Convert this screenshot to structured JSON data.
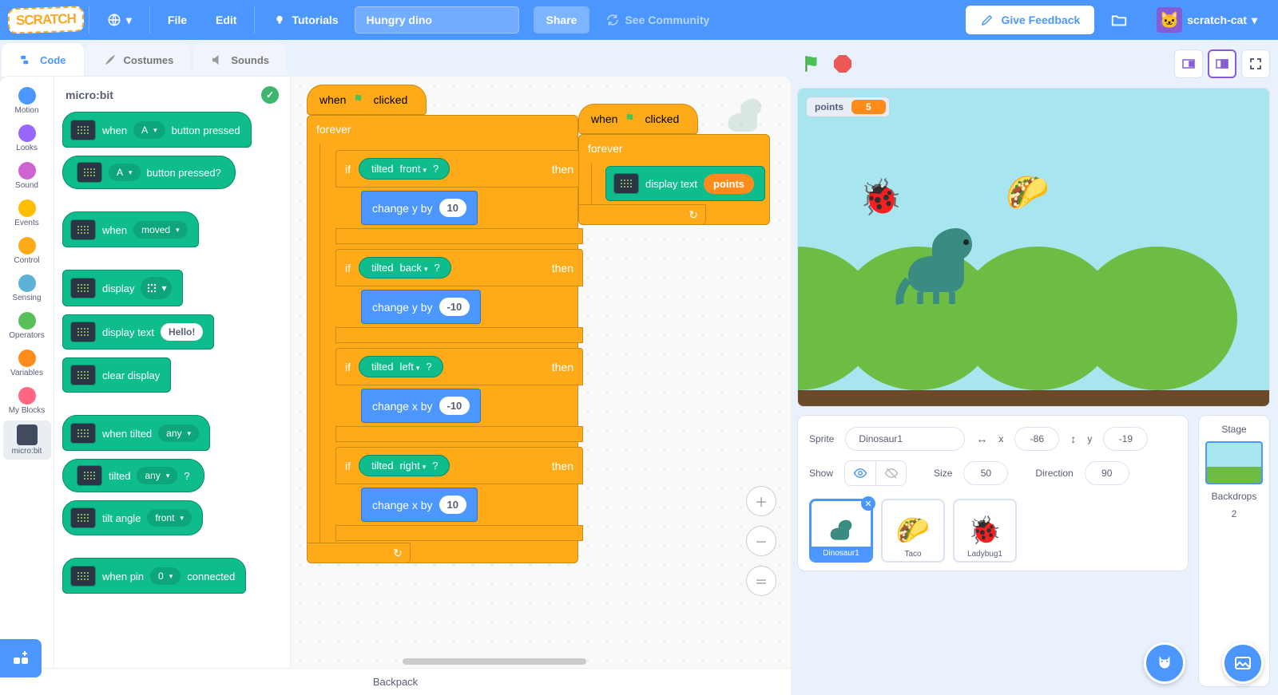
{
  "menubar": {
    "logo": "SCRATCH",
    "file": "File",
    "edit": "Edit",
    "tutorials": "Tutorials",
    "project_title": "Hungry dino",
    "share": "Share",
    "see_community": "See Community",
    "give_feedback": "Give Feedback",
    "username": "scratch-cat"
  },
  "tabs": {
    "code": "Code",
    "costumes": "Costumes",
    "sounds": "Sounds"
  },
  "categories": [
    {
      "label": "Motion",
      "color": "#4c97ff"
    },
    {
      "label": "Looks",
      "color": "#9966ff"
    },
    {
      "label": "Sound",
      "color": "#cf63cf"
    },
    {
      "label": "Events",
      "color": "#ffbf00"
    },
    {
      "label": "Control",
      "color": "#ffab19"
    },
    {
      "label": "Sensing",
      "color": "#5cb1d6"
    },
    {
      "label": "Operators",
      "color": "#59c059"
    },
    {
      "label": "Variables",
      "color": "#ff8c1a"
    },
    {
      "label": "My Blocks",
      "color": "#ff6680"
    },
    {
      "label": "micro:bit",
      "color": "#424a60"
    }
  ],
  "palette": {
    "title": "micro:bit",
    "blocks": {
      "when_button": {
        "when": "when",
        "option": "A",
        "button_pressed": "button pressed"
      },
      "button_pressed_bool": {
        "option": "A",
        "text": "button pressed?"
      },
      "when_moved": {
        "when": "when",
        "option": "moved"
      },
      "display": "display",
      "display_text": {
        "label": "display text",
        "value": "Hello!"
      },
      "clear": "clear display",
      "when_tilted": {
        "label": "when tilted",
        "option": "any"
      },
      "tilted_bool": {
        "label": "tilted",
        "option": "any",
        "q": "?"
      },
      "tilt_angle": {
        "label": "tilt angle",
        "option": "front"
      },
      "when_pin": {
        "label": "when pin",
        "option": "0",
        "connected": "connected"
      }
    }
  },
  "workspace": {
    "hat1": {
      "when": "when",
      "clicked": "clicked"
    },
    "forever": "forever",
    "if": "if",
    "then": "then",
    "tilted": "tilted",
    "q": "?",
    "dirs": {
      "front": "front",
      "back": "back",
      "left": "left",
      "right": "right"
    },
    "change_y": "change y by",
    "change_x": "change x by",
    "vals": {
      "p10": "10",
      "n10": "-10"
    },
    "display_text": "display text",
    "points": "points"
  },
  "stage": {
    "var_name": "points",
    "var_value": "5"
  },
  "sprite_info": {
    "sprite_label": "Sprite",
    "name": "Dinosaur1",
    "x_label": "x",
    "x": "-86",
    "y_label": "y",
    "y": "-19",
    "show_label": "Show",
    "size_label": "Size",
    "size": "50",
    "direction_label": "Direction",
    "direction": "90"
  },
  "sprites": [
    {
      "name": "Dinosaur1"
    },
    {
      "name": "Taco"
    },
    {
      "name": "Ladybug1"
    }
  ],
  "stage_panel": {
    "title": "Stage",
    "backdrops_label": "Backdrops",
    "backdrops_count": "2"
  },
  "backpack": "Backpack"
}
